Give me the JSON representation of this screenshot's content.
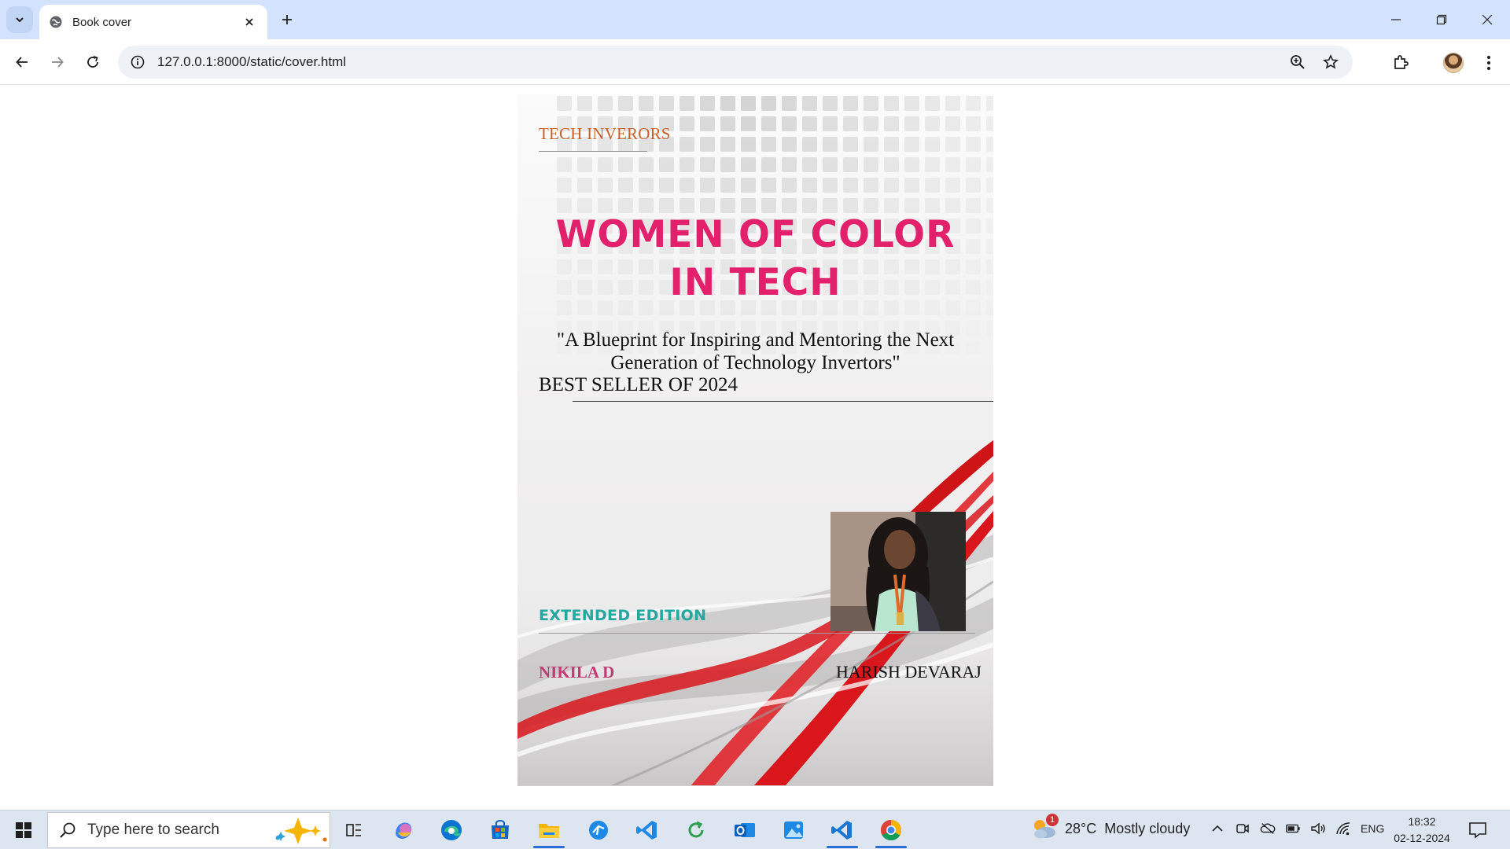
{
  "browser": {
    "tab_title": "Book cover",
    "url": "127.0.0.1:8000/static/cover.html",
    "icons": {
      "tab_search": "chevron-down-icon",
      "favicon": "globe-icon",
      "tab_close": "close-icon",
      "new_tab": "plus-icon",
      "back": "back-arrow-icon",
      "forward": "forward-arrow-icon",
      "reload": "reload-icon",
      "site_info": "info-icon",
      "zoom": "zoom-icon",
      "bookmark": "star-icon",
      "extensions": "puzzle-icon",
      "menu": "kebab-menu-icon"
    }
  },
  "cover": {
    "publisher": "TECH INVERORS",
    "title": "WOMEN OF COLOR IN TECH",
    "tagline": "\"A Blueprint for Inspiring and Mentoring the Next Generation of Technology Invertors\"",
    "bestseller": "BEST SELLER OF 2024",
    "edition": "EXTENDED EDITION",
    "author_left": "NIKILA D",
    "author_right": "HARISH DEVARAJ",
    "colors": {
      "title": "#e2206b",
      "publisher": "#c9602a",
      "edition": "#25a7a1",
      "author_left": "#c23b73",
      "wave_red": "#d8161c"
    }
  },
  "taskbar": {
    "search_placeholder": "Type here to search",
    "weather_temp": "28°C",
    "weather_desc": "Mostly cloudy",
    "weather_badge": "1",
    "language": "ENG",
    "time": "18:32",
    "date": "02-12-2024",
    "apps": [
      "task-view-icon",
      "copilot-icon",
      "edge-icon",
      "store-icon",
      "file-explorer-icon",
      "remote-icon",
      "vscode-icon",
      "refresh-app-icon",
      "outlook-icon",
      "photos-icon",
      "vscode-insiders-icon",
      "chrome-icon"
    ]
  }
}
